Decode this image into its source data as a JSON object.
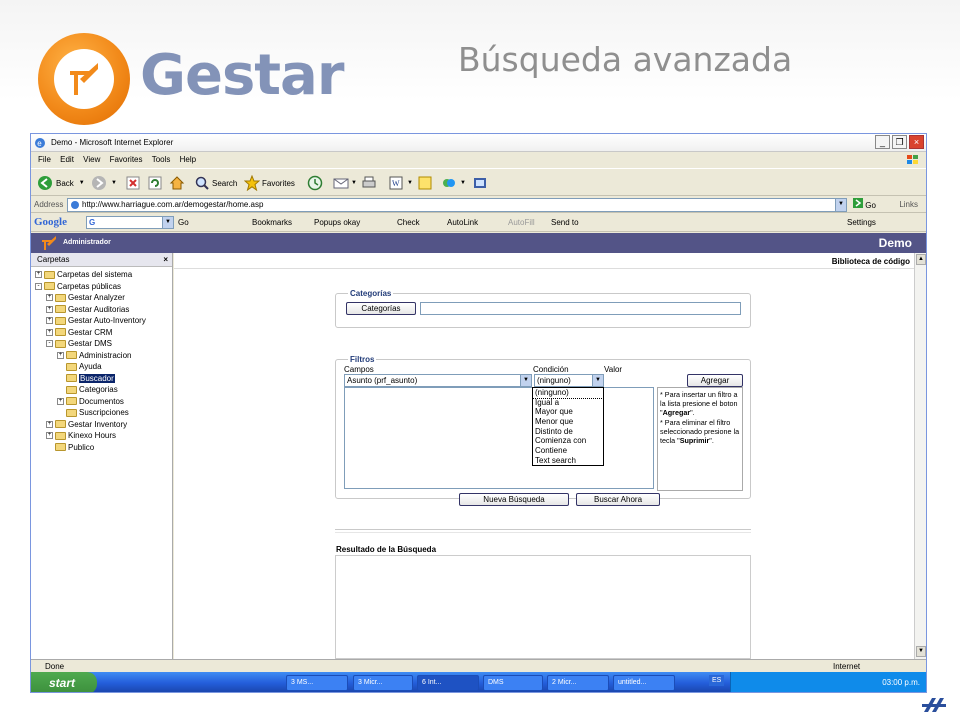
{
  "slide": {
    "logo_text": "Gestar",
    "title": "Búsqueda avanzada"
  },
  "browser": {
    "window_title": "Demo - Microsoft Internet Explorer",
    "menu": [
      "File",
      "Edit",
      "View",
      "Favorites",
      "Tools",
      "Help"
    ],
    "toolbar": {
      "back": "Back",
      "search": "Search",
      "favorites": "Favorites"
    },
    "address": {
      "label": "Address",
      "url": "http://www.harriague.com.ar/demogestar/home.asp",
      "go": "Go",
      "links": "Links"
    },
    "google_bar": {
      "brand": "Google",
      "go": "Go",
      "bookmarks": "Bookmarks",
      "popups": "Popups okay",
      "check": "Check",
      "autolink": "AutoLink",
      "autofill": "AutoFill",
      "send_to": "Send to",
      "settings": "Settings"
    },
    "status": {
      "left": "Done",
      "zone": "Internet"
    }
  },
  "app": {
    "user": "Administrador",
    "workspace": "Demo",
    "section_title": "Biblioteca de código",
    "sidebar": {
      "title": "Carpetas",
      "close": "×",
      "items": [
        {
          "label": "Carpetas del sistema",
          "level": 0,
          "toggle": "+"
        },
        {
          "label": "Carpetas públicas",
          "level": 0,
          "toggle": "-"
        },
        {
          "label": "Gestar Analyzer",
          "level": 1,
          "toggle": "+"
        },
        {
          "label": "Gestar Auditorias",
          "level": 1,
          "toggle": "+"
        },
        {
          "label": "Gestar Auto-Inventory",
          "level": 1,
          "toggle": "+"
        },
        {
          "label": "Gestar CRM",
          "level": 1,
          "toggle": "+"
        },
        {
          "label": "Gestar DMS",
          "level": 1,
          "toggle": "-"
        },
        {
          "label": "Administracion",
          "level": 2,
          "toggle": "+"
        },
        {
          "label": "Ayuda",
          "level": 2,
          "toggle": ""
        },
        {
          "label": "Buscador",
          "level": 2,
          "toggle": "",
          "selected": true
        },
        {
          "label": "Categorias",
          "level": 2,
          "toggle": ""
        },
        {
          "label": "Documentos",
          "level": 2,
          "toggle": "+"
        },
        {
          "label": "Suscripciones",
          "level": 2,
          "toggle": ""
        },
        {
          "label": "Gestar Inventory",
          "level": 1,
          "toggle": "+"
        },
        {
          "label": "Kinexo Hours",
          "level": 1,
          "toggle": "+"
        },
        {
          "label": "Publico",
          "level": 1,
          "toggle": ""
        }
      ]
    },
    "categorias": {
      "legend": "Categorías",
      "button": "Categorías",
      "value": ""
    },
    "filtros": {
      "legend": "Filtros",
      "campos_label": "Campos",
      "condicion_label": "Condición",
      "valor_label": "Valor",
      "campo_selected": "Asunto (prf_asunto)",
      "condicion_selected": "(ninguno)",
      "add_button": "Agregar",
      "condition_options": [
        "(ninguno)",
        "Igual a",
        "Mayor que",
        "Menor que",
        "Distinto de",
        "Comienza con",
        "Contiene",
        "Text search"
      ],
      "help": {
        "line1": "* Para insertar un filtro a la lista presione el boton \"",
        "line1_bold": "Agregar",
        "line1_end": "\".",
        "line2": "* Para eliminar el filtro seleccionado presione la tecla \"",
        "line2_bold": "Suprimir",
        "line2_end": "\"."
      },
      "new_search": "Nueva Búsqueda",
      "search_now": "Buscar Ahora"
    },
    "results": {
      "title": "Resultado de la Búsqueda"
    }
  },
  "taskbar": {
    "start": "start",
    "tasks": [
      "3 MS...",
      "3 Micr...",
      "6 Int...",
      "DMS",
      "2 Micr...",
      "untitled...",
      "ES"
    ],
    "clock": "03:00 p.m."
  }
}
